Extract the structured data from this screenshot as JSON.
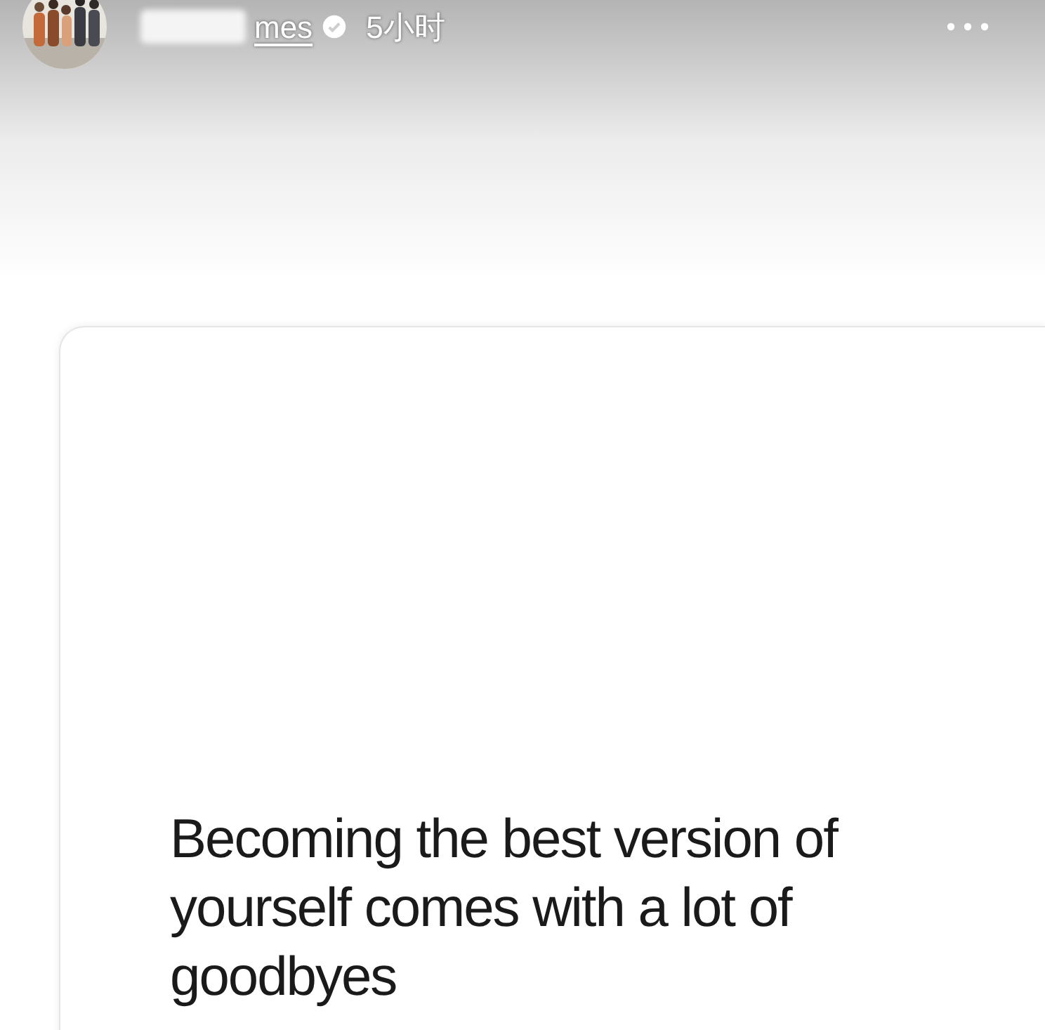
{
  "header": {
    "username": "mes",
    "verified": true,
    "time": "5小时"
  },
  "post": {
    "text": "Becoming the best version of yourself comes with a lot of goodbyes"
  }
}
